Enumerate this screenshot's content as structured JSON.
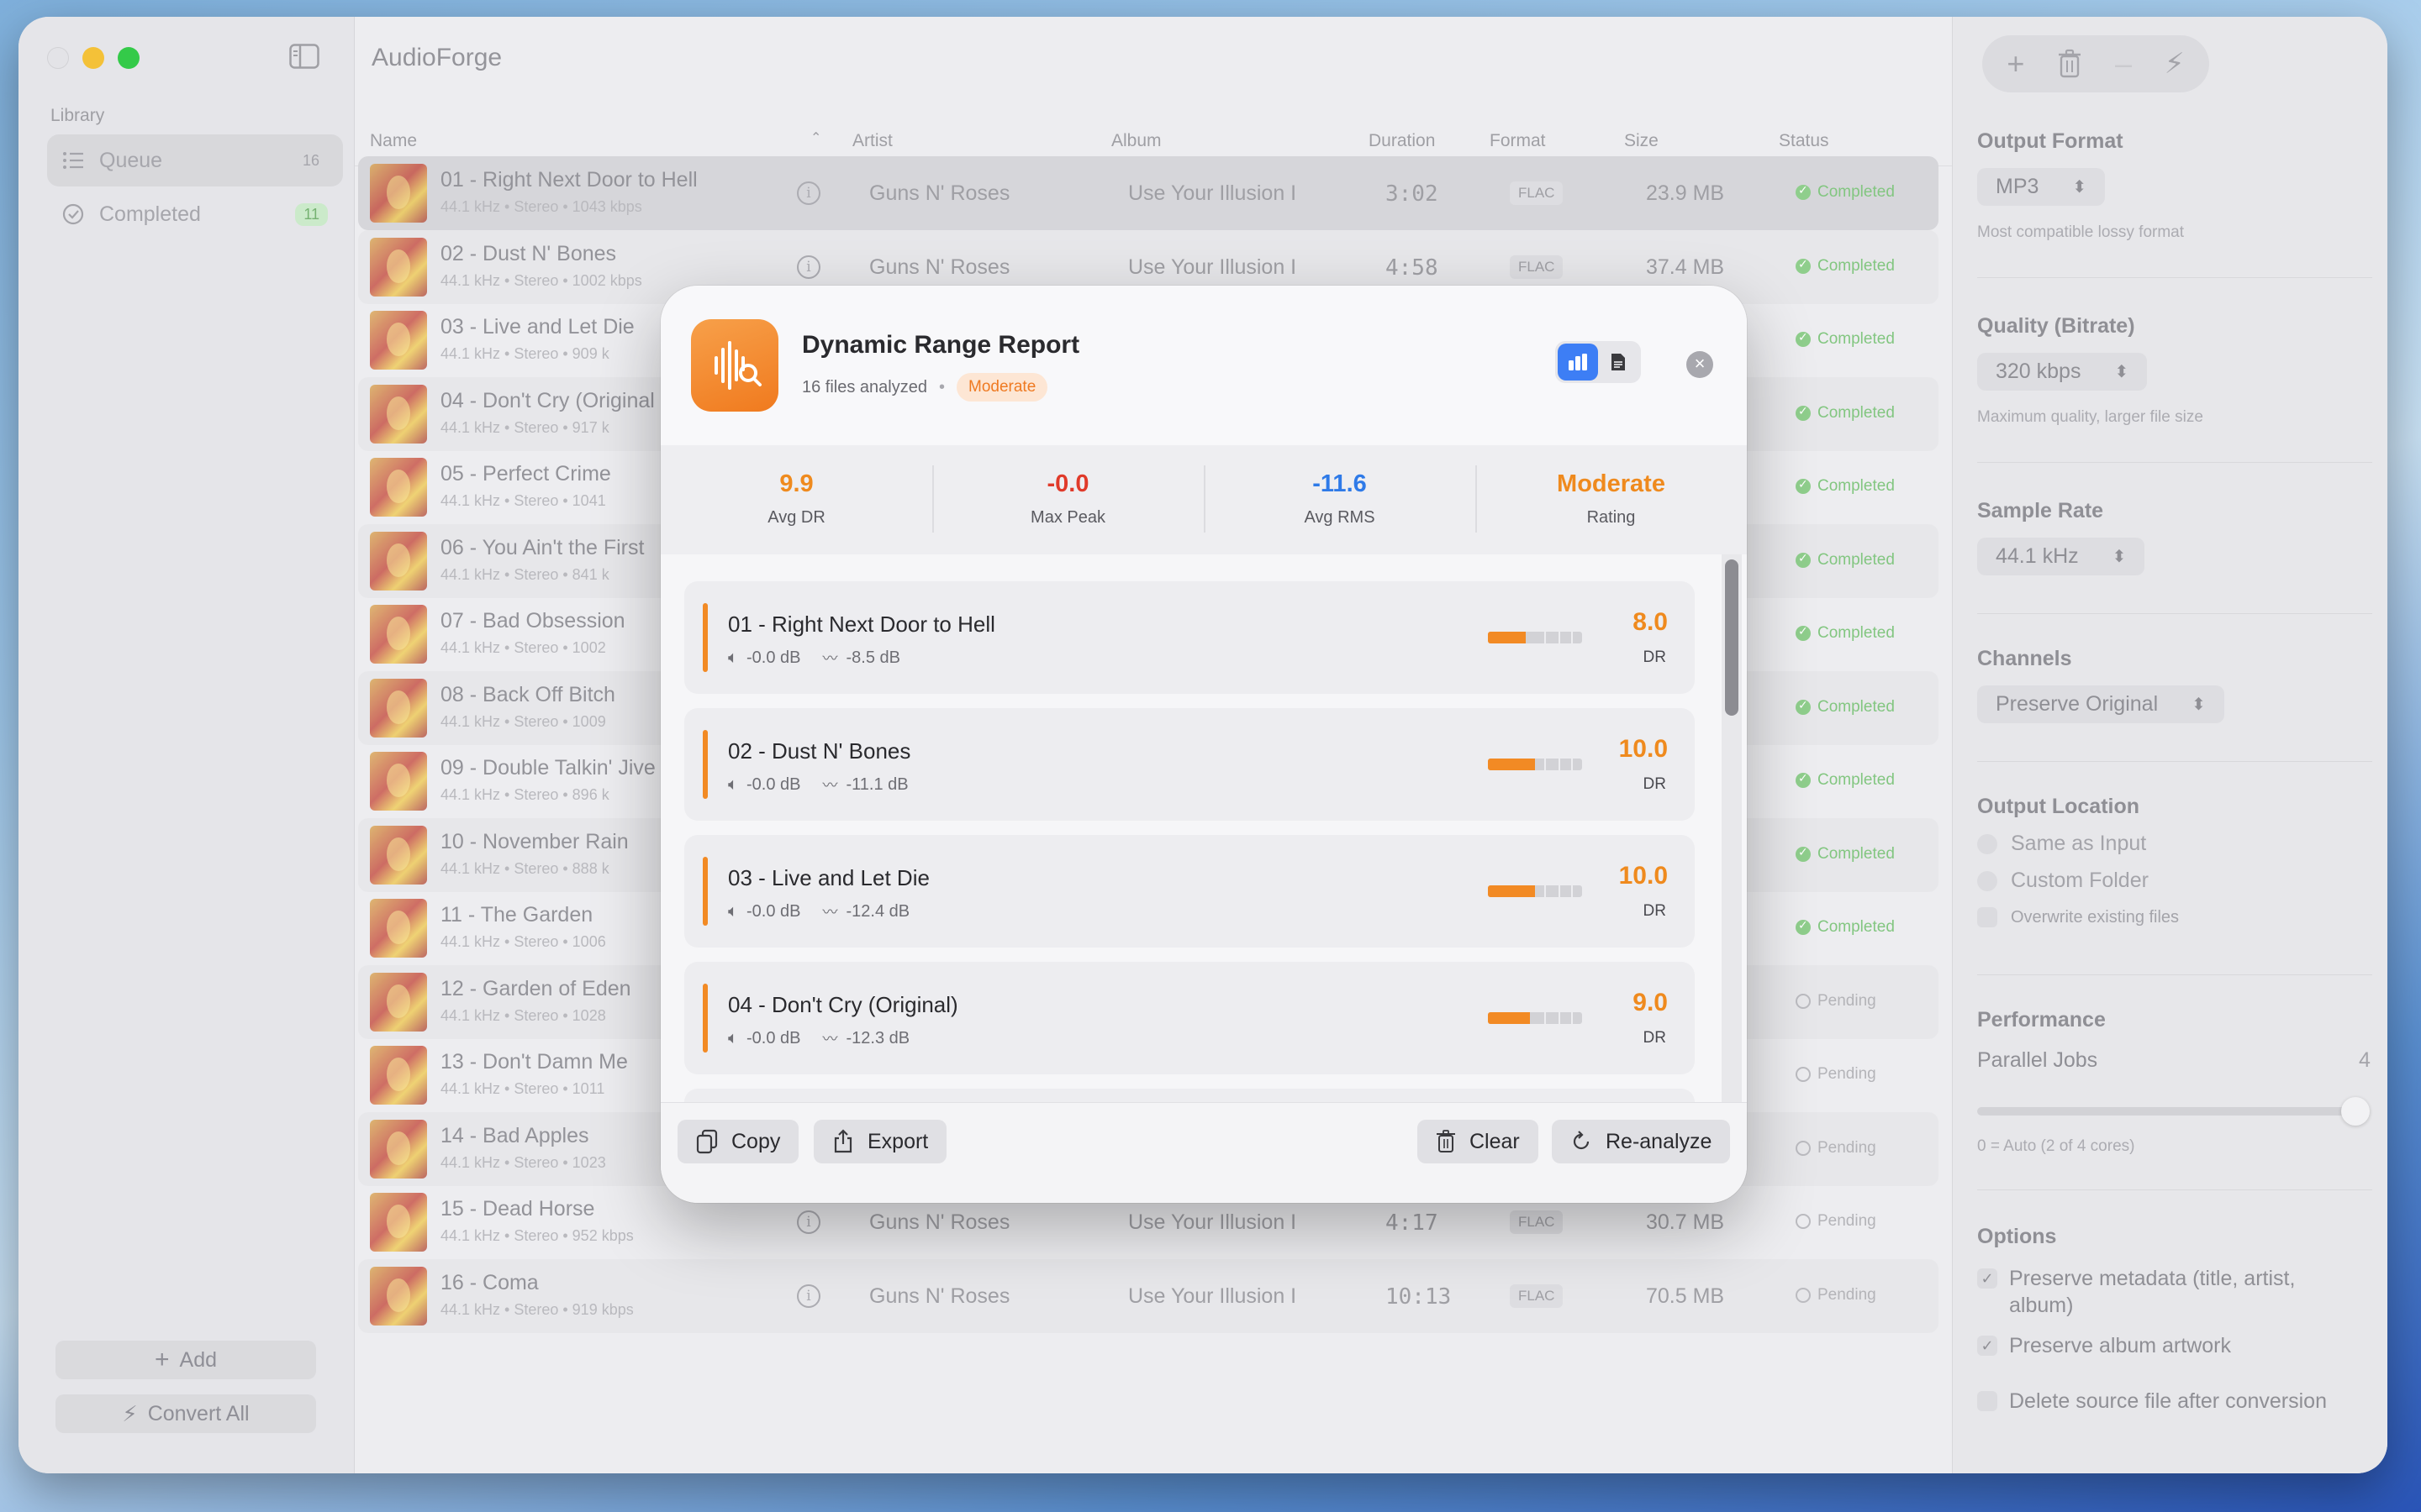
{
  "app": {
    "title": "AudioForge"
  },
  "sidebar": {
    "section": "Library",
    "items": [
      {
        "label": "Queue",
        "count": "16"
      },
      {
        "label": "Completed",
        "count": "11"
      }
    ],
    "add_label": "Add",
    "convert_label": "Convert All"
  },
  "table": {
    "columns": [
      "Name",
      "Artist",
      "Album",
      "Duration",
      "Format",
      "Size",
      "Status"
    ],
    "rows": [
      {
        "name": "01 - Right Next Door to Hell",
        "meta": "44.1 kHz  •  Stereo  •  1043 kbps",
        "artist": "Guns N' Roses",
        "album": "Use Your Illusion I",
        "duration": "3:02",
        "format": "FLAC",
        "size": "23.9 MB",
        "status": "Completed"
      },
      {
        "name": "02 - Dust N' Bones",
        "meta": "44.1 kHz  •  Stereo  •  1002 kbps",
        "artist": "Guns N' Roses",
        "album": "Use Your Illusion I",
        "duration": "4:58",
        "format": "FLAC",
        "size": "37.4 MB",
        "status": "Completed"
      },
      {
        "name": "03 - Live and Let Die",
        "meta": "44.1 kHz  •  Stereo  •  909 k",
        "artist": "",
        "album": "",
        "duration": "",
        "format": "",
        "size": "",
        "status": "Completed"
      },
      {
        "name": "04 - Don't Cry (Original",
        "meta": "44.1 kHz  •  Stereo  •  917 k",
        "artist": "",
        "album": "",
        "duration": "",
        "format": "",
        "size": "",
        "status": "Completed"
      },
      {
        "name": "05 - Perfect Crime",
        "meta": "44.1 kHz  •  Stereo  •  1041",
        "artist": "",
        "album": "",
        "duration": "",
        "format": "",
        "size": "",
        "status": "Completed"
      },
      {
        "name": "06 - You Ain't the First",
        "meta": "44.1 kHz  •  Stereo  •  841 k",
        "artist": "",
        "album": "",
        "duration": "",
        "format": "",
        "size": "",
        "status": "Completed"
      },
      {
        "name": "07 - Bad Obsession",
        "meta": "44.1 kHz  •  Stereo  •  1002",
        "artist": "",
        "album": "",
        "duration": "",
        "format": "",
        "size": "",
        "status": "Completed"
      },
      {
        "name": "08 - Back Off Bitch",
        "meta": "44.1 kHz  •  Stereo  •  1009",
        "artist": "",
        "album": "",
        "duration": "",
        "format": "",
        "size": "",
        "status": "Completed"
      },
      {
        "name": "09 - Double Talkin' Jive",
        "meta": "44.1 kHz  •  Stereo  •  896 k",
        "artist": "",
        "album": "",
        "duration": "",
        "format": "",
        "size": "",
        "status": "Completed"
      },
      {
        "name": "10 - November Rain",
        "meta": "44.1 kHz  •  Stereo  •  888 k",
        "artist": "",
        "album": "",
        "duration": "",
        "format": "",
        "size": "",
        "status": "Completed"
      },
      {
        "name": "11 - The Garden",
        "meta": "44.1 kHz  •  Stereo  •  1006",
        "artist": "",
        "album": "",
        "duration": "",
        "format": "",
        "size": "",
        "status": "Completed"
      },
      {
        "name": "12 - Garden of Eden",
        "meta": "44.1 kHz  •  Stereo  •  1028",
        "artist": "",
        "album": "",
        "duration": "",
        "format": "",
        "size": "",
        "status": "Pending"
      },
      {
        "name": "13 - Don't Damn Me",
        "meta": "44.1 kHz  •  Stereo  •  1011",
        "artist": "",
        "album": "",
        "duration": "",
        "format": "",
        "size": "",
        "status": "Pending"
      },
      {
        "name": "14 - Bad Apples",
        "meta": "44.1 kHz  •  Stereo  •  1023",
        "artist": "",
        "album": "",
        "duration": "",
        "format": "",
        "size": "",
        "status": "Pending"
      },
      {
        "name": "15 - Dead Horse",
        "meta": "44.1 kHz  •  Stereo  •  952 kbps",
        "artist": "Guns N' Roses",
        "album": "Use Your Illusion I",
        "duration": "4:17",
        "format": "FLAC",
        "size": "30.7 MB",
        "status": "Pending"
      },
      {
        "name": "16 - Coma",
        "meta": "44.1 kHz  •  Stereo  •  919 kbps",
        "artist": "Guns N' Roses",
        "album": "Use Your Illusion I",
        "duration": "10:13",
        "format": "FLAC",
        "size": "70.5 MB",
        "status": "Pending"
      }
    ]
  },
  "settings": {
    "output_format": {
      "title": "Output Format",
      "value": "MP3",
      "hint": "Most compatible lossy format"
    },
    "quality": {
      "title": "Quality (Bitrate)",
      "value": "320 kbps",
      "hint": "Maximum quality, larger file size"
    },
    "sample_rate": {
      "title": "Sample Rate",
      "value": "44.1 kHz"
    },
    "channels": {
      "title": "Channels",
      "value": "Preserve Original"
    },
    "output_location": {
      "title": "Output Location",
      "same": "Same as Input",
      "custom": "Custom Folder",
      "overwrite": "Overwrite existing files"
    },
    "performance": {
      "title": "Performance",
      "parallel_label": "Parallel Jobs",
      "parallel_value": "4",
      "hint": "0 = Auto (2 of 4 cores)",
      "slider_fraction": 1.0
    },
    "options": {
      "title": "Options",
      "metadata": "Preserve metadata (title, artist, album)",
      "artwork": "Preserve album artwork",
      "delete_source": "Delete source file after conversion"
    }
  },
  "modal": {
    "title": "Dynamic Range Report",
    "subtitle": "16 files analyzed",
    "badge": "Moderate",
    "stats": [
      {
        "value": "9.9",
        "label": "Avg DR"
      },
      {
        "value": "-0.0",
        "label": "Max Peak"
      },
      {
        "value": "-11.6",
        "label": "Avg RMS"
      },
      {
        "value": "Moderate",
        "label": "Rating"
      }
    ],
    "tracks": [
      {
        "title": "01 - Right Next Door to Hell",
        "peak": "-0.0 dB",
        "rms": "-8.5 dB",
        "dr": "8.0",
        "dr_label": "DR",
        "fraction": 0.4
      },
      {
        "title": "02 - Dust N' Bones",
        "peak": "-0.0 dB",
        "rms": "-11.1 dB",
        "dr": "10.0",
        "dr_label": "DR",
        "fraction": 0.5
      },
      {
        "title": "03 - Live and Let Die",
        "peak": "-0.0 dB",
        "rms": "-12.4 dB",
        "dr": "10.0",
        "dr_label": "DR",
        "fraction": 0.5
      },
      {
        "title": "04 - Don't Cry (Original)",
        "peak": "-0.0 dB",
        "rms": "-12.3 dB",
        "dr": "9.0",
        "dr_label": "DR",
        "fraction": 0.45
      }
    ],
    "footer": {
      "copy": "Copy",
      "export": "Export",
      "clear": "Clear",
      "reanalyze": "Re-analyze"
    }
  },
  "colors": {
    "accent": "#F28A24",
    "blue": "#3D7EF5",
    "peak_red": "#E03A2A",
    "rms_blue": "#2E7AE8",
    "completed_green": "#7CC37A"
  }
}
